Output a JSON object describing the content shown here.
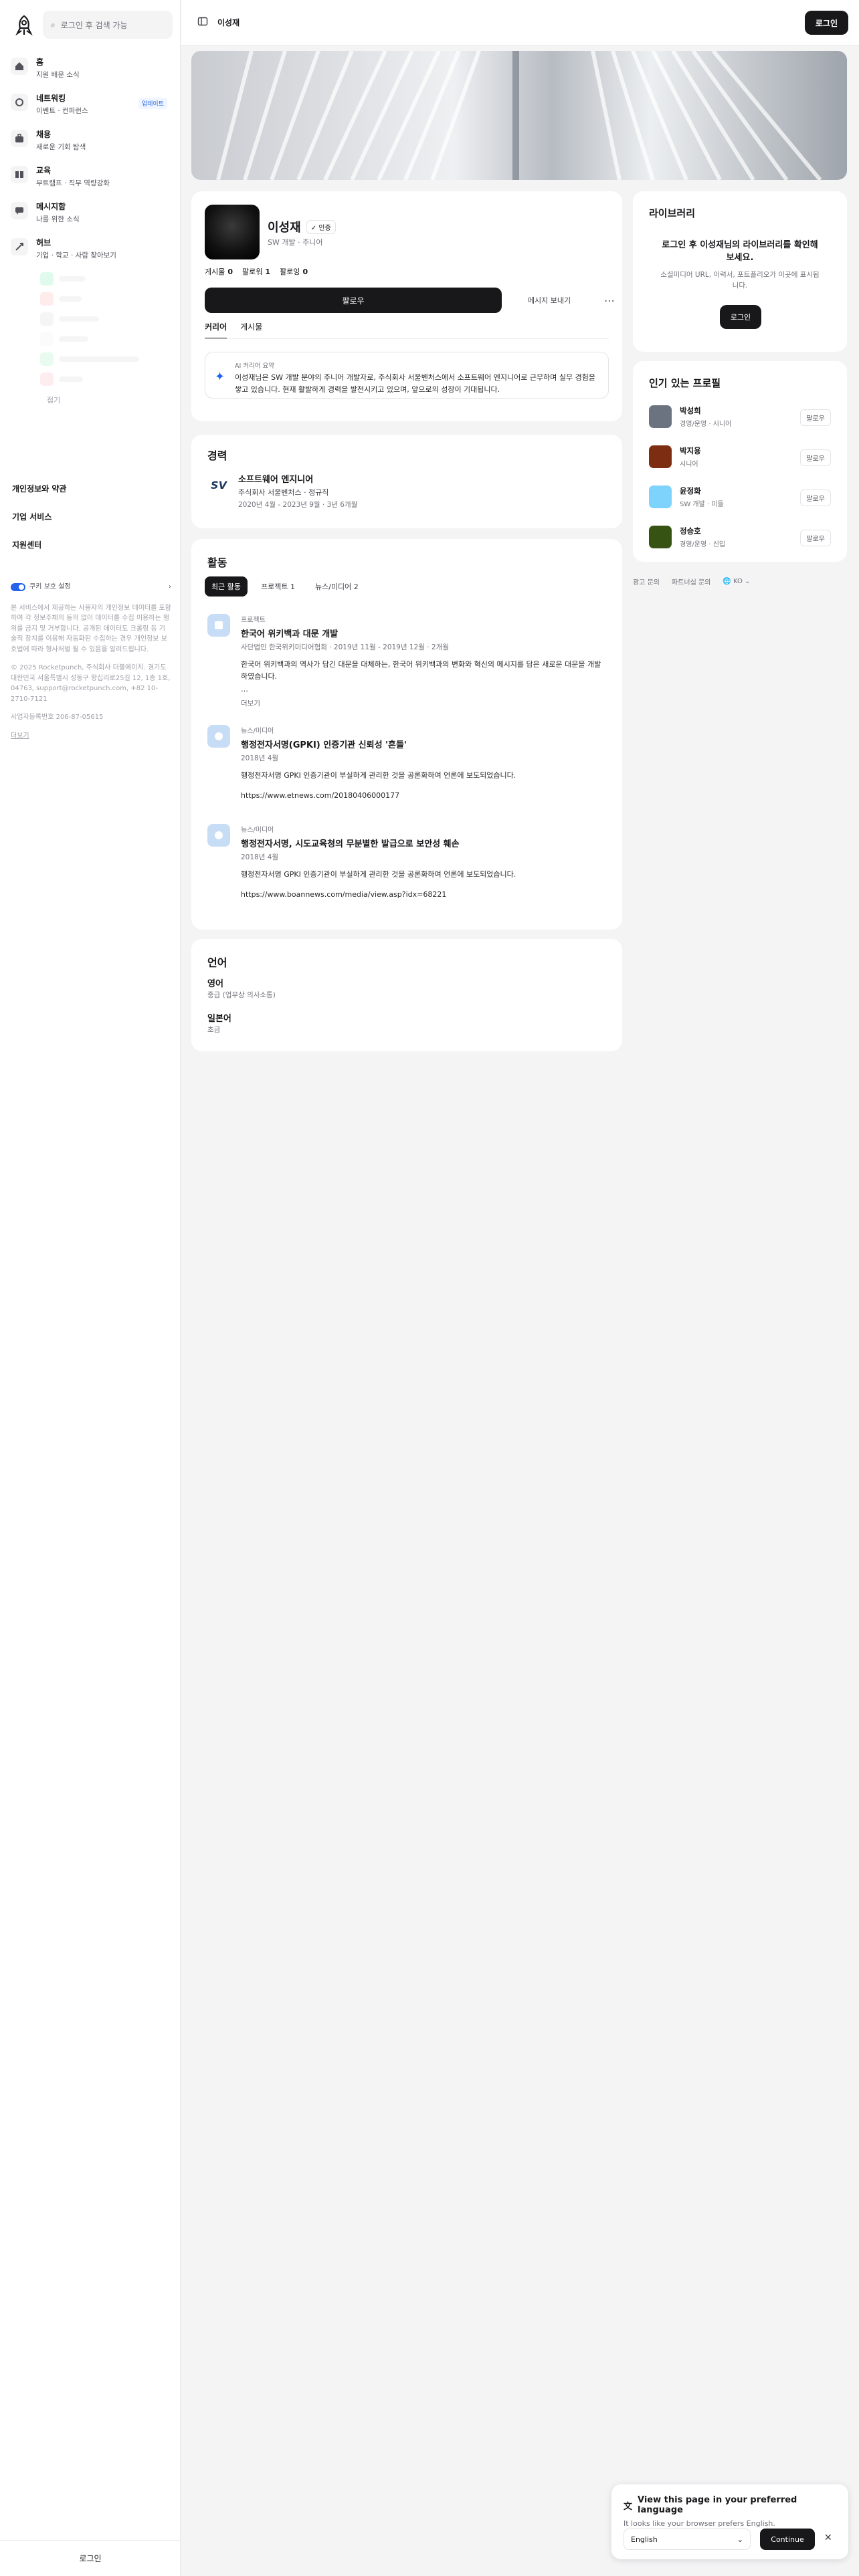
{
  "sidebar": {
    "search_placeholder": "로그인 후 검색 가능",
    "nav": [
      {
        "title": "홈",
        "sub": "지원 배운 소식",
        "icon": "home-icon"
      },
      {
        "title": "네트워킹",
        "sub": "이벤트 · 컨퍼런스",
        "icon": "network-icon",
        "badge": "업데이트"
      },
      {
        "title": "채용",
        "sub": "새로운 기회 탐색",
        "icon": "briefcase-icon"
      },
      {
        "title": "교육",
        "sub": "부트캠프 · 직무 역량강화",
        "icon": "book-icon"
      },
      {
        "title": "메시지함",
        "sub": "나를 위한 소식",
        "icon": "message-icon"
      },
      {
        "title": "허브",
        "sub": "기업 · 학교 · 사람 찾아보기",
        "icon": "hub-icon"
      }
    ],
    "fold_label": "접기",
    "legal_links": [
      "개인정보와 약관",
      "기업 서비스",
      "지원센터"
    ],
    "privacy_toggle_label": "쿠키 보호 설정",
    "privacy_text": "본 서비스에서 제공하는 사용자의 개인정보 데이터를 포함하여 각 정보주체의 동의 없이 데이터를 수집 이용하는 행위를 금지 및 거부합니다. 공개된 데이터도 크롤링 등 기술적 장치를 이용해 자동화된 수집하는 경우 개인정보 보호법에 따라 형사처벌 될 수 있음을 알려드립니다.",
    "company_info": "© 2025 Rocketpunch, 주식회사 더블에이치. 경기도 대한민국 서울특별시 성동구 왕십리로25길 12, 1층 1호, 04763, support@rocketpunch.com, +82 10-2710-7121",
    "biz_number": "사업자등록번호 206-87-05615",
    "fold_label2": "더보기",
    "login_label": "로그인"
  },
  "topbar": {
    "title": "이성재",
    "login_label": "로그인"
  },
  "profile": {
    "name": "이성재",
    "verified": "✓ 인증",
    "headline": "SW 개발 · 주니어",
    "stats": [
      {
        "label": "게시물",
        "value": "0"
      },
      {
        "label": "팔로워",
        "value": "1"
      },
      {
        "label": "팔로잉",
        "value": "0"
      }
    ],
    "follow_label": "팔로우",
    "message_label": "메시지 보내기",
    "more_label": "⋯",
    "tabs": [
      "커리어",
      "게시물"
    ],
    "ai_label": "AI 커리어 요약",
    "ai_text": "이성재님은 SW 개발 분야의 주니어 개발자로, 주식회사 서울벤처스에서 소프트웨어 엔지니어로 근무하며 실무 경험을 쌓고 있습니다. 현재 활발하게 경력을 발전시키고 있으며, 앞으로의 성장이 기대됩니다."
  },
  "experience": {
    "title": "경력",
    "logo_text": "SV",
    "role": "소프트웨어 엔지니어",
    "company": "주식회사 서울벤처스 · 정규직",
    "period": "2020년 4월 - 2023년 9월 · 3년 6개월"
  },
  "activity": {
    "title": "활동",
    "tabs": [
      "최근 활동",
      "프로젝트 1",
      "뉴스/미디어 2"
    ],
    "items": [
      {
        "category": "프로젝트",
        "title": "한국어 위키백과 대문 개발",
        "date": "사단법인 한국위키미디어협회 · 2019년 11월 - 2019년 12월 · 2개월",
        "desc": "한국어 위키백과의 역사가 담긴 대문을 대체하는, 한국어 위키백과의 변화와 혁신의 메시지를 담은 새로운 대문을 개발하였습니다.",
        "extra": "…",
        "more": "더보기"
      },
      {
        "category": "뉴스/미디어",
        "title": "행정전자서명(GPKI) 인증기관 신뢰성 '흔들'",
        "date": "2018년 4월",
        "desc": "행정전자서명 GPKI 인증기관이 부실하게 관리한 것을 공론화하여 언론에 보도되었습니다.",
        "url": "https://www.etnews.com/20180406000177"
      },
      {
        "category": "뉴스/미디어",
        "title": "행정전자서명, 시도교육청의 무분별한 발급으로 보안성 훼손",
        "date": "2018년 4월",
        "desc": "행정전자서명 GPKI 인증기관이 부실하게 관리한 것을 공론화하여 언론에 보도되었습니다.",
        "url": "https://www.boannews.com/media/view.asp?idx=68221"
      }
    ]
  },
  "languages": {
    "title": "언어",
    "items": [
      {
        "name": "영어",
        "level": "중급 (업무상 의사소통)"
      },
      {
        "name": "일본어",
        "level": "초급"
      }
    ]
  },
  "library": {
    "title": "라이브러리",
    "headline": "로그인 후 이성재님의 라이브러리를 확인해보세요.",
    "desc": "소셜미디어 URL, 이력서, 포트폴리오가 이곳에 표시됩니다.",
    "login_label": "로그인"
  },
  "popular": {
    "title": "인기 있는 프로필",
    "follow_label": "팔로우",
    "people": [
      {
        "name": "박성희",
        "sub": "경영/운영 · 시니어"
      },
      {
        "name": "박지용",
        "sub": "시니어"
      },
      {
        "name": "윤정화",
        "sub": "SW 개발 · 미들"
      },
      {
        "name": "정승호",
        "sub": "경영/운영 · 신입"
      }
    ]
  },
  "footer_links": [
    "광고 문의",
    "파트너십 문의",
    "KO"
  ],
  "lang_popup": {
    "title": "View this page in your preferred language",
    "sub": "It looks like your browser prefers English.",
    "select_value": "English",
    "continue_label": "Continue",
    "close_label": "✕"
  },
  "colors": {
    "accent": "#2563eb",
    "dark": "#18181b"
  }
}
